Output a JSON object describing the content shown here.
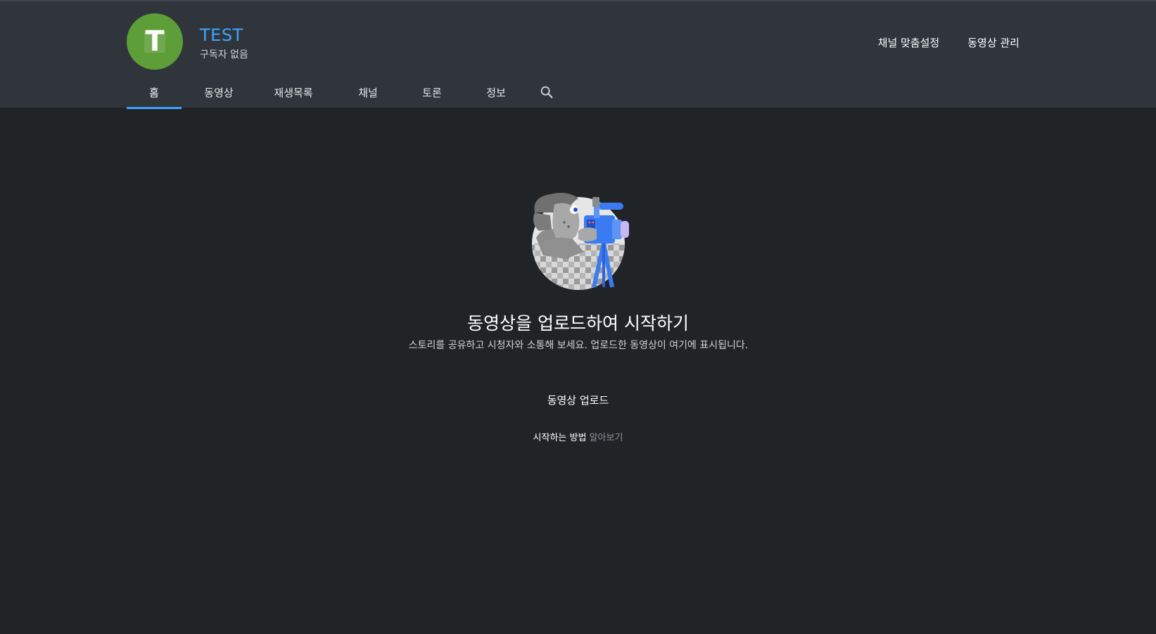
{
  "channel": {
    "avatar_letter": "T",
    "avatar_color": "#5e9e38",
    "name": "TEST",
    "subscribers": "구독자 없음"
  },
  "header_actions": {
    "customize": "채널 맞춤설정",
    "manage_videos": "동영상 관리"
  },
  "tabs": [
    {
      "label": "홈",
      "active": true
    },
    {
      "label": "동영상",
      "active": false
    },
    {
      "label": "재생목록",
      "active": false
    },
    {
      "label": "채널",
      "active": false
    },
    {
      "label": "토론",
      "active": false
    },
    {
      "label": "정보",
      "active": false
    }
  ],
  "search_icon": "search-icon",
  "empty_state": {
    "illustration": "camera-operator-illustration",
    "title": "동영상을 업로드하여 시작하기",
    "description": "스토리를 공유하고 시청자와 소통해 보세요. 업로드한 동영상이 여기에 표시됩니다.",
    "upload_button": "동영상 업로드",
    "help_prefix": "시작하는 방법",
    "help_link": "알아보기"
  },
  "colors": {
    "accent": "#3ea6ff",
    "background": "#212427",
    "header": "#30353b"
  }
}
